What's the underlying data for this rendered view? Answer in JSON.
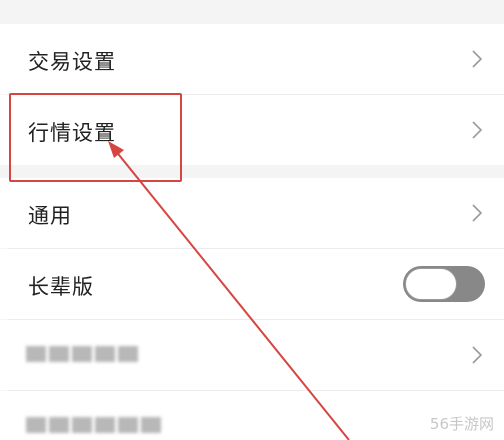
{
  "settings": {
    "trade": {
      "label": "交易设置"
    },
    "market": {
      "label": "行情设置"
    },
    "general": {
      "label": "通用"
    },
    "elder": {
      "label": "长辈版",
      "toggle_on": false
    }
  },
  "annotation": {
    "color": "#d64541"
  },
  "watermark": {
    "text": "56手游网"
  }
}
